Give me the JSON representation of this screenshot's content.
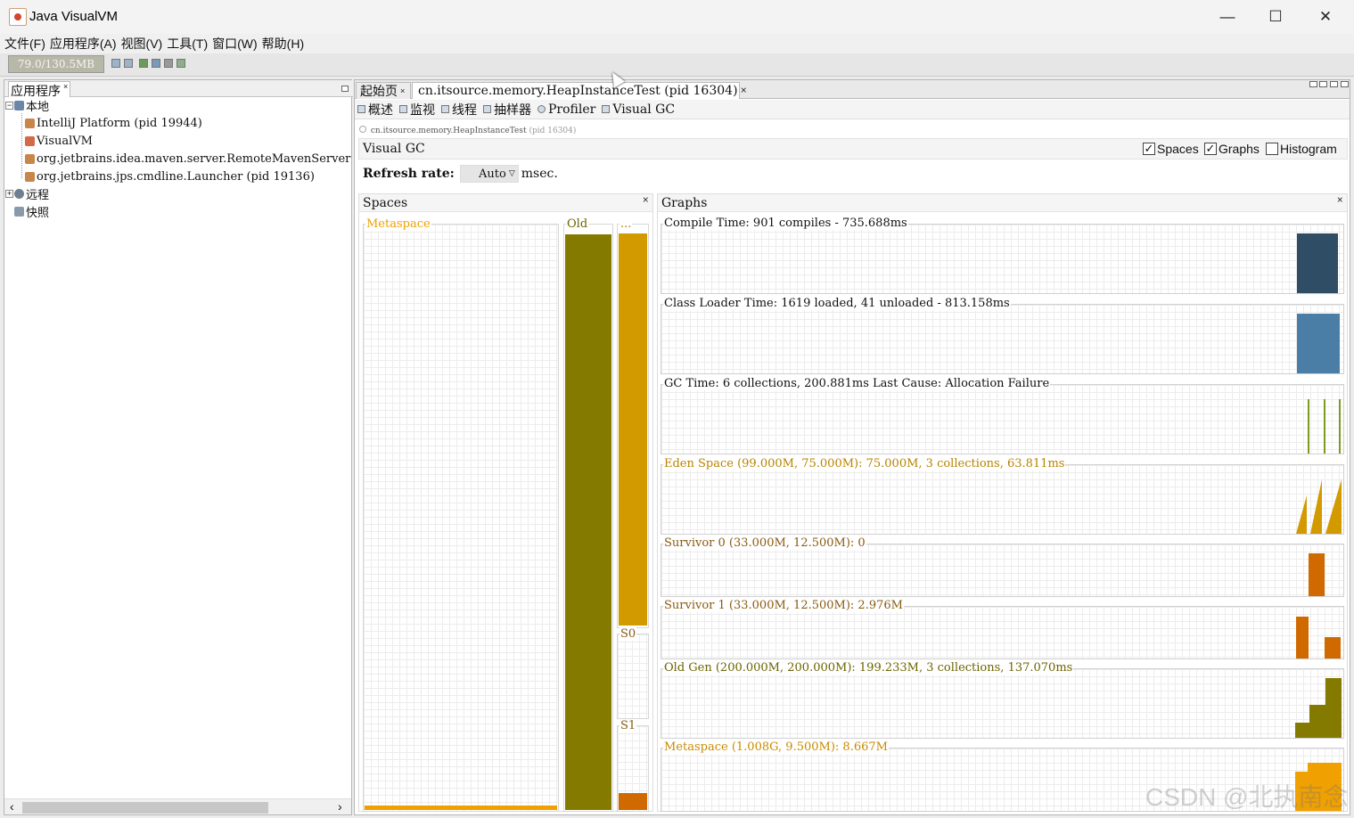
{
  "window": {
    "title": "Java VisualVM",
    "minimize_glyph": "—",
    "maximize_glyph": "☐",
    "close_glyph": "✕"
  },
  "menu": [
    "文件(F)",
    "应用程序(A)",
    "视图(V)",
    "工具(T)",
    "窗口(W)",
    "帮助(H)"
  ],
  "toolbar": {
    "memory": "79.0/130.5MB"
  },
  "left_panel": {
    "tab_label": "应用程序",
    "tab_close": "×",
    "tree": [
      {
        "label": "本地",
        "level": 0,
        "icon": "host-icon",
        "expander": "−"
      },
      {
        "label": "IntelliJ Platform (pid 19944)",
        "level": 1,
        "icon": "app-icon"
      },
      {
        "label": "VisualVM",
        "level": 1,
        "icon": "visualvm-icon"
      },
      {
        "label": "org.jetbrains.idea.maven.server.RemoteMavenServer",
        "level": 1,
        "icon": "app-icon"
      },
      {
        "label": "org.jetbrains.jps.cmdline.Launcher (pid 19136)",
        "level": 1,
        "icon": "app-icon"
      },
      {
        "label": "远程",
        "level": 0,
        "icon": "remote-icon",
        "expander": "+"
      },
      {
        "label": "快照",
        "level": 0,
        "icon": "snapshot-icon"
      }
    ],
    "scroll_left": "‹",
    "scroll_right": "›"
  },
  "tabs": {
    "start": "起始页",
    "process": "cn.itsource.memory.HeapInstanceTest (pid 16304)",
    "close": "×"
  },
  "subtabs": [
    "概述",
    "监视",
    "线程",
    "抽样器",
    "Profiler",
    "Visual GC"
  ],
  "process_line": "cn.itsource.memory.HeapInstanceTest",
  "process_pid": "(pid 16304)",
  "visual_gc": {
    "title": "Visual GC",
    "checkboxes": [
      {
        "label": "Spaces",
        "checked": true
      },
      {
        "label": "Graphs",
        "checked": true
      },
      {
        "label": "Histogram",
        "checked": false
      }
    ],
    "refresh_label": "Refresh rate:",
    "refresh_value": "Auto",
    "refresh_unit": "msec."
  },
  "spaces": {
    "title": "Spaces",
    "close": "×",
    "metaspace": "Metaspace",
    "old": "Old",
    "eden": "...",
    "s0": "S0",
    "s1": "S1"
  },
  "graphs_panel": {
    "title": "Graphs",
    "close": "×",
    "items": [
      {
        "label": "Compile Time: 901 compiles - 735.688ms",
        "color": "#2f4e66",
        "label_color": "#222222"
      },
      {
        "label": "Class Loader Time: 1619 loaded, 41 unloaded - 813.158ms",
        "color": "#4b7ea6",
        "label_color": "#3c5f7e"
      },
      {
        "label": "GC Time: 6 collections, 200.881ms Last Cause: Allocation Failure",
        "color": "#7f9a1e",
        "label_color": "#7d8a1a"
      },
      {
        "label": "Eden Space (99.000M, 75.000M): 75.000M, 3 collections, 63.811ms",
        "color": "#d39a00",
        "label_color": "#b88400"
      },
      {
        "label": "Survivor 0 (33.000M, 12.500M): 0",
        "color": "#d06a00",
        "label_color": "#8a5a10"
      },
      {
        "label": "Survivor 1 (33.000M, 12.500M): 2.976M",
        "color": "#d06a00",
        "label_color": "#8a5a10"
      },
      {
        "label": "Old Gen (200.000M, 200.000M): 199.233M, 3 collections, 137.070ms",
        "color": "#857a00",
        "label_color": "#6d6400"
      },
      {
        "label": "Metaspace (1.008G, 9.500M): 8.667M",
        "color": "#f0a000",
        "label_color": "#c98a00"
      }
    ]
  },
  "colors": {
    "metaspace": "#f0a000",
    "old": "#857a00",
    "eden": "#d39a00",
    "survivor": "#d06a00"
  },
  "watermark": "CSDN @北执南念"
}
